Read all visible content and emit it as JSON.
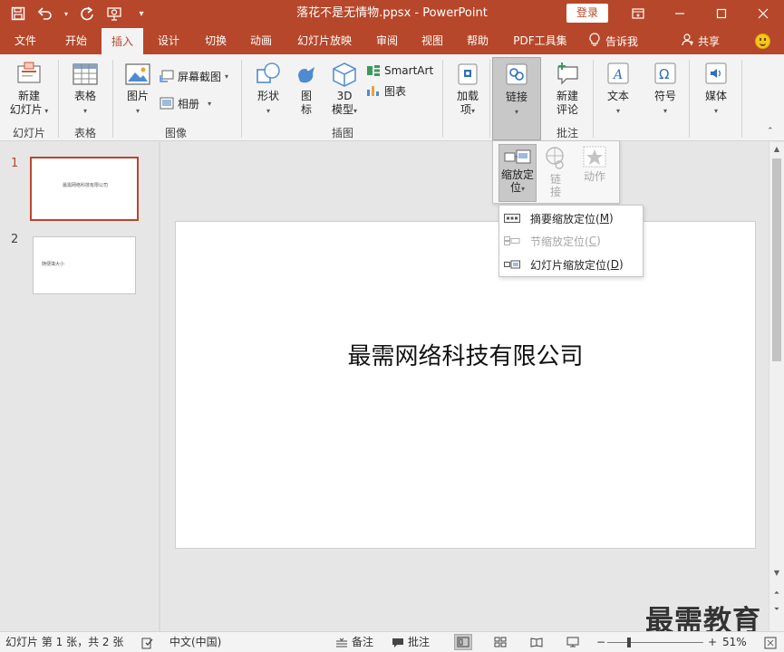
{
  "window": {
    "document_title": "落花不是无情物.ppsx - PowerPoint",
    "login_label": "登录"
  },
  "tabs": [
    {
      "label": "文件",
      "active": false
    },
    {
      "label": "开始",
      "active": false
    },
    {
      "label": "插入",
      "active": true
    },
    {
      "label": "设计",
      "active": false
    },
    {
      "label": "切换",
      "active": false
    },
    {
      "label": "动画",
      "active": false
    },
    {
      "label": "幻灯片放映",
      "active": false
    },
    {
      "label": "审阅",
      "active": false
    },
    {
      "label": "视图",
      "active": false
    },
    {
      "label": "帮助",
      "active": false
    },
    {
      "label": "PDF工具集",
      "active": false
    }
  ],
  "tell_me": "告诉我",
  "share": "共享",
  "ribbon": {
    "new_slide": {
      "line1": "新建",
      "line2": "幻灯片"
    },
    "table": "表格",
    "picture": "图片",
    "screenshot": "屏幕截图",
    "album": "相册",
    "shapes": "形状",
    "icons": {
      "line1": "图",
      "line2": "标"
    },
    "model3d": {
      "line1": "3D",
      "line2": "模型"
    },
    "smartart": "SmartArt",
    "chart": "图表",
    "addins": {
      "line1": "加载",
      "line2": "项"
    },
    "links": "链接",
    "new_comment": {
      "line1": "新建",
      "line2": "评论"
    },
    "text": "文本",
    "symbols": "符号",
    "media": "媒体",
    "groups": {
      "slides": "幻灯片",
      "tables": "表格",
      "images": "图像",
      "illustrations": "插图",
      "comments": "批注"
    }
  },
  "link_dropdown": {
    "zoom": {
      "line1": "缩放定",
      "line2": "位"
    },
    "link": {
      "line1": "链",
      "line2": "接"
    },
    "action": "动作"
  },
  "zoom_menu": [
    {
      "label": "摘要缩放定位(",
      "key": "M",
      "suffix": ")",
      "enabled": true
    },
    {
      "label": "节缩放定位(",
      "key": "C",
      "suffix": ")",
      "enabled": false
    },
    {
      "label": "幻灯片缩放定位(",
      "key": "D",
      "suffix": ")",
      "enabled": true
    }
  ],
  "thumbnails": [
    {
      "number": "1",
      "text": "最需网络科技有限公司",
      "selected": true
    },
    {
      "number": "2",
      "text": "随便填大小",
      "selected": false
    }
  ],
  "slide": {
    "title": "最需网络科技有限公司"
  },
  "watermark": "最需教育",
  "status": {
    "slide_info": "幻灯片 第 1 张，共 2 张",
    "language": "中文(中国)",
    "notes": "备注",
    "comments": "批注",
    "zoom_level": "51%",
    "zoom_minus": "−",
    "zoom_plus": "+"
  },
  "colors": {
    "brand": "#b7472a",
    "ribbon_bg": "#f3f3f3"
  }
}
